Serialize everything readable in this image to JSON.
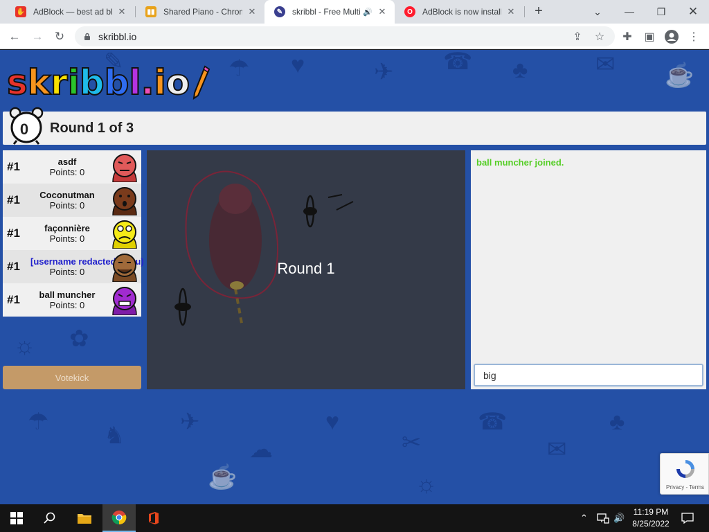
{
  "browser": {
    "tabs": [
      {
        "title": "AdBlock — best ad blo",
        "icon": "adblock-icon",
        "active": false
      },
      {
        "title": "Shared Piano - Chrome",
        "icon": "shared-piano-icon",
        "active": false
      },
      {
        "title": "skribbl - Free Multi",
        "icon": "skribbl-icon",
        "active": true
      },
      {
        "title": "AdBlock is now installe",
        "icon": "opera-icon",
        "active": false
      }
    ],
    "url": "skribbl.io"
  },
  "game": {
    "logo_letters": [
      "s",
      "k",
      "r",
      "i",
      "b",
      "b",
      "l",
      ".",
      "i",
      "o"
    ],
    "logo_colors": [
      "#e8332a",
      "#f7941d",
      "#f9e000",
      "#2bc42b",
      "#1fbbe9",
      "#2f6cf0",
      "#b433e1",
      "#ef4fb8",
      "#f7941d",
      "#eeeeee"
    ],
    "timer": "0",
    "round_text": "Round 1 of 3",
    "players": [
      {
        "rank": "#1",
        "name": "asdf",
        "points": "Points: 0",
        "avatar_color": "#e05a5a",
        "you": false
      },
      {
        "rank": "#1",
        "name": "Coconutman",
        "points": "Points: 0",
        "avatar_color": "#7a3b1c",
        "you": false
      },
      {
        "rank": "#1",
        "name": "façonnière",
        "points": "Points: 0",
        "avatar_color": "#f5ea18",
        "you": false
      },
      {
        "rank": "#1",
        "name": "[username redacted] (You)",
        "points": "Points: 0",
        "avatar_color": "#a06a3a",
        "you": true
      },
      {
        "rank": "#1",
        "name": "ball muncher",
        "points": "Points: 0",
        "avatar_color": "#a02bd0",
        "you": false
      }
    ],
    "votekick_label": "Votekick",
    "canvas_overlay": "Round 1",
    "chat_messages": [
      {
        "text": "ball muncher joined.",
        "color": "#56ce27"
      }
    ],
    "chat_input_value": "big "
  },
  "recaptcha": {
    "links": "Privacy - Terms"
  },
  "taskbar": {
    "time": "11:19 PM",
    "date": "8/25/2022"
  }
}
